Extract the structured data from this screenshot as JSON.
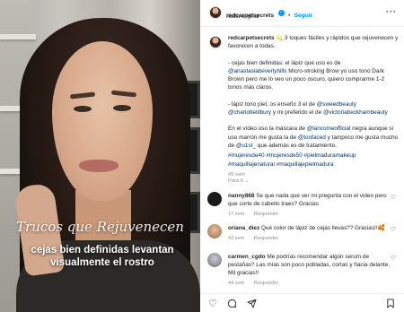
{
  "video": {
    "script_caption": "Trucos que Rejuvenecen",
    "caption_line1": "cejas bien definidas levantan",
    "caption_line2": "visualmente el rostro"
  },
  "header": {
    "username": "redcarpetsecrets",
    "verified_mark": "✓",
    "separator": "•",
    "follow_label": "Seguir",
    "audio": "Audio original",
    "more_icon": "more-horizontal-icon"
  },
  "post": {
    "username": "redcarpetsecrets",
    "p1": "💫 3 toques fáciles y rápidos que rejuvenecen y favorecen a todas.",
    "p2a": "- cejas bien definidas: el lápiz que uso es de ",
    "p2link": "@anastasiabeverlyhills",
    "p2b": " Micro-stroking Brow yo uso tono Dark Brown pero me lo veo un poco oscuro, quiero comprarme 1-2 tonos más claros.",
    "p3a": "- lápiz tono piel, os enseño 3 el de ",
    "p3link1": "@sweedbeauty",
    "p3link2": "@charlottetilbury",
    "p3b": " y mi preferido el de ",
    "p3link3": "@victoriabeckhambeauty",
    "p4a": "En el vídeo uso la máscara de ",
    "p4link1": "@lancomeofficial",
    "p4b": " negra aunque si uso marrón me gusta la de ",
    "p4link2": "@toofaced",
    "p4c": " y tampoco me gusta mucho de ",
    "p4link3": "@u1st_",
    "p4d": " que además es de tratamiento.",
    "hashtags": "#mujeresde40 #mujeresde50 #pielmaduramakeup #maquillajenatural #maquillajepielmadura",
    "age": "45 sem",
    "translate": "Para ti",
    "chevron": "⌄"
  },
  "comments": [
    {
      "user": "nanny868",
      "text": "Se que nada que ver mi pregunta con el video pero que corte de cabello traes? Gracias",
      "age": "17 sem",
      "reply": "Responder",
      "avatar_color": "#1a1a1a"
    },
    {
      "user": "oriana_diez",
      "text": "Qué color de lápiz de cejas llevas?? Gracias!!🥰",
      "age": "43 sem",
      "reply": "Responder",
      "avatar_color": "#c9a27c"
    },
    {
      "user": "carmen_cgdo",
      "text": "Me podrías recomendar algún serum de pestañas? Las mías son poco pobladas, cortas y hacia delante. Mil gracias!!",
      "age": "44 sem",
      "reply": "Responder",
      "avatar_color": "#9aa0a8"
    }
  ],
  "icons": {
    "like": "heart-icon",
    "comment": "comment-icon",
    "share": "share-icon",
    "save": "bookmark-icon"
  }
}
